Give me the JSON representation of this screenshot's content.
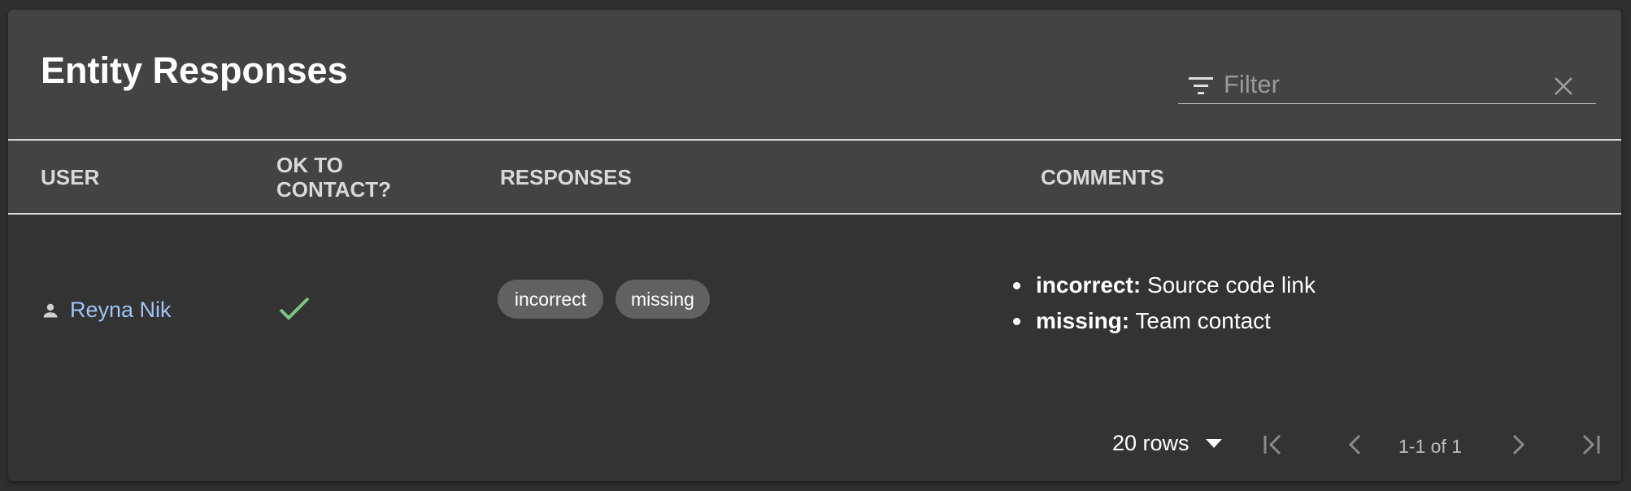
{
  "panel": {
    "title": "Entity Responses"
  },
  "filter": {
    "placeholder": "Filter",
    "value": ""
  },
  "table": {
    "columns": [
      "USER",
      "OK TO CONTACT?",
      "RESPONSES",
      "COMMENTS"
    ],
    "rows": [
      {
        "user": "Reyna Nik",
        "ok_to_contact": true,
        "responses": [
          "incorrect",
          "missing"
        ],
        "comments": [
          {
            "label": "incorrect:",
            "text": "Source code link"
          },
          {
            "label": "missing:",
            "text": "Team contact"
          }
        ]
      }
    ]
  },
  "pagination": {
    "rows_per_page": "20 rows",
    "range": "1-1 of 1"
  },
  "icons": {
    "filter": "filter-icon",
    "clear": "close-icon",
    "user": "person-icon",
    "ok": "check-icon",
    "first": "first-page-icon",
    "prev": "chevron-left-icon",
    "next": "chevron-right-icon",
    "last": "last-page-icon"
  },
  "colors": {
    "background": "#2f2f2f",
    "panel": "#333333",
    "header": "#434343",
    "link": "#9ec5f7",
    "check": "#7bc47f",
    "chip": "#616161"
  }
}
